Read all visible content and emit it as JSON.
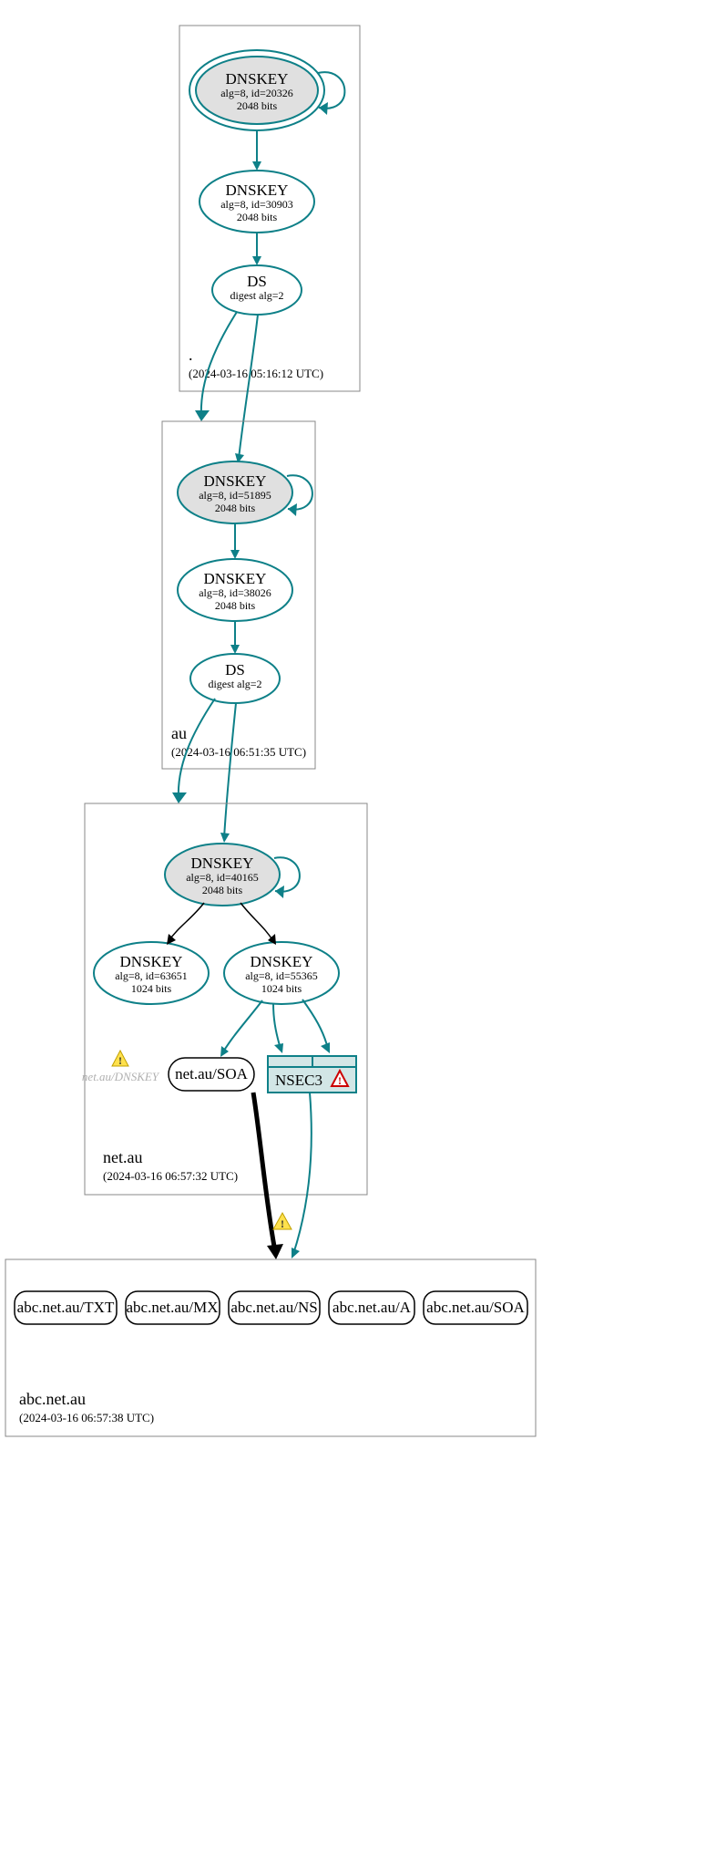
{
  "zones": {
    "root": {
      "label": ".",
      "time": "(2024-03-16 05:16:12 UTC)"
    },
    "au": {
      "label": "au",
      "time": "(2024-03-16 06:51:35 UTC)"
    },
    "netau": {
      "label": "net.au",
      "time": "(2024-03-16 06:57:32 UTC)"
    },
    "abc": {
      "label": "abc.net.au",
      "time": "(2024-03-16 06:57:38 UTC)"
    }
  },
  "nodes": {
    "root_ksk": {
      "title": "DNSKEY",
      "line2": "alg=8, id=20326",
      "line3": "2048 bits"
    },
    "root_zsk": {
      "title": "DNSKEY",
      "line2": "alg=8, id=30903",
      "line3": "2048 bits"
    },
    "root_ds": {
      "title": "DS",
      "line2": "digest alg=2"
    },
    "au_ksk": {
      "title": "DNSKEY",
      "line2": "alg=8, id=51895",
      "line3": "2048 bits"
    },
    "au_zsk": {
      "title": "DNSKEY",
      "line2": "alg=8, id=38026",
      "line3": "2048 bits"
    },
    "au_ds": {
      "title": "DS",
      "line2": "digest alg=2"
    },
    "netau_ksk": {
      "title": "DNSKEY",
      "line2": "alg=8, id=40165",
      "line3": "2048 bits"
    },
    "netau_zsk1": {
      "title": "DNSKEY",
      "line2": "alg=8, id=63651",
      "line3": "1024 bits"
    },
    "netau_zsk2": {
      "title": "DNSKEY",
      "line2": "alg=8, id=55365",
      "line3": "1024 bits"
    },
    "netau_soa": {
      "title": "net.au/SOA"
    },
    "netau_nsec": {
      "title": "NSEC3"
    },
    "ghost": {
      "title": "net.au/DNSKEY"
    }
  },
  "rrs": {
    "txt": "abc.net.au/TXT",
    "mx": "abc.net.au/MX",
    "ns": "abc.net.au/NS",
    "a": "abc.net.au/A",
    "soa": "abc.net.au/SOA"
  }
}
